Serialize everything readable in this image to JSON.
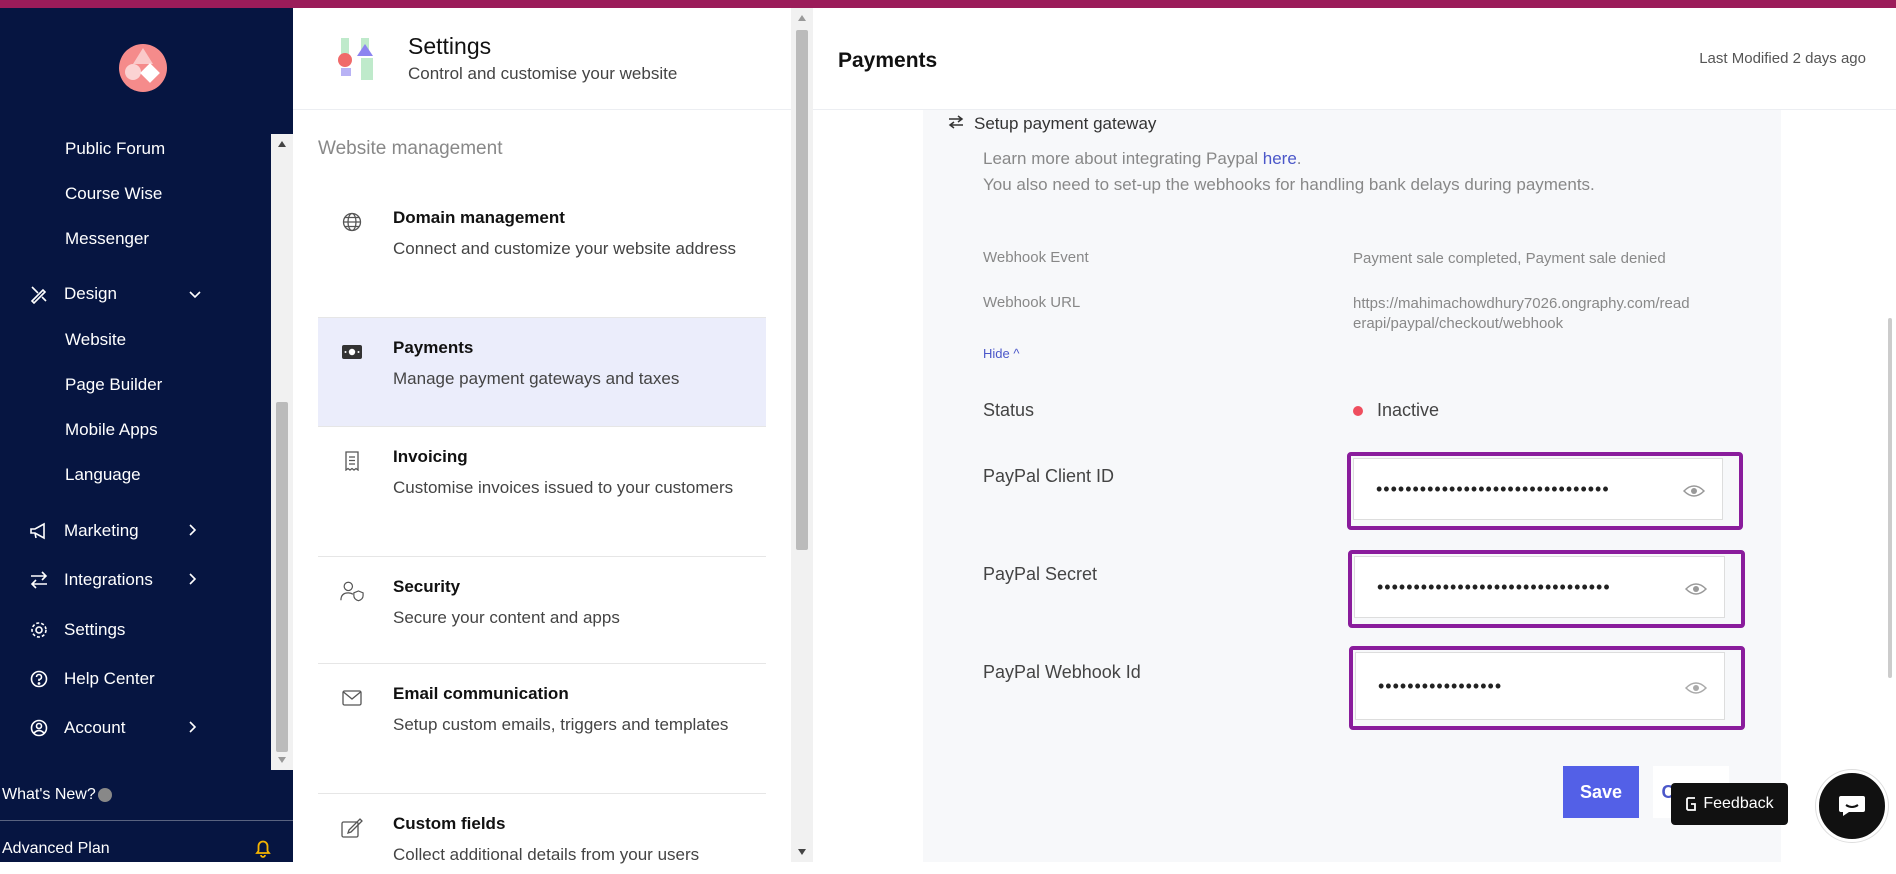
{
  "nav": {
    "sub_items_top": [
      "Public Forum",
      "Course Wise",
      "Messenger"
    ],
    "design_label": "Design",
    "design_items": [
      "Website",
      "Page Builder",
      "Mobile Apps",
      "Language"
    ],
    "marketing_label": "Marketing",
    "integrations_label": "Integrations",
    "settings_label": "Settings",
    "help_label": "Help Center",
    "account_label": "Account",
    "whats_new": "What's New?",
    "plan": "Advanced Plan"
  },
  "settings_panel": {
    "title": "Settings",
    "subtitle": "Control and customise your website",
    "section": "Website management",
    "cards": [
      {
        "title": "Domain management",
        "desc": "Connect and customize your website address",
        "icon": "globe-icon"
      },
      {
        "title": "Payments",
        "desc": "Manage payment gateways and taxes",
        "icon": "money-icon"
      },
      {
        "title": "Invoicing",
        "desc": "Customise invoices issued to your customers",
        "icon": "receipt-icon"
      },
      {
        "title": "Security",
        "desc": "Secure your content and apps",
        "icon": "user-shield-icon"
      },
      {
        "title": "Email communication",
        "desc": "Setup custom emails, triggers and templates",
        "icon": "mail-icon"
      },
      {
        "title": "Custom fields",
        "desc": "Collect additional details from your users",
        "icon": "edit-icon"
      }
    ]
  },
  "payments": {
    "title": "Payments",
    "modified": "Last Modified 2 days ago",
    "gateway_label": "Setup payment gateway",
    "learn_prefix": "Learn more about integrating Paypal ",
    "learn_link": "here",
    "learn_suffix": ".",
    "webhook_note": "You also need to set-up the webhooks for handling bank delays during payments.",
    "webhook_event_label": "Webhook Event",
    "webhook_event_value": "Payment sale completed, Payment sale denied",
    "webhook_url_label": "Webhook URL",
    "webhook_url_value": "https://mahimachowdhury7026.ongraphy.com/read erapi/paypal/checkout/webhook",
    "hide_label": "Hide ^",
    "status_label": "Status",
    "status_value": "Inactive",
    "client_id_label": "PayPal Client ID",
    "client_id_value": "••••••••••••••••••••••••••••••••",
    "secret_label": "PayPal Secret",
    "secret_value": "••••••••••••••••••••••••••••••••",
    "webhook_id_label": "PayPal Webhook Id",
    "webhook_id_value": "•••••••••••••••••",
    "save": "Save",
    "cancel": "Cancel"
  },
  "widgets": {
    "feedback": "Feedback"
  },
  "colors": {
    "nav_bg": "#061541",
    "accent": "#5360e7",
    "highlight_box": "#8a1c9c",
    "inactive_dot": "#ef4e5e"
  }
}
